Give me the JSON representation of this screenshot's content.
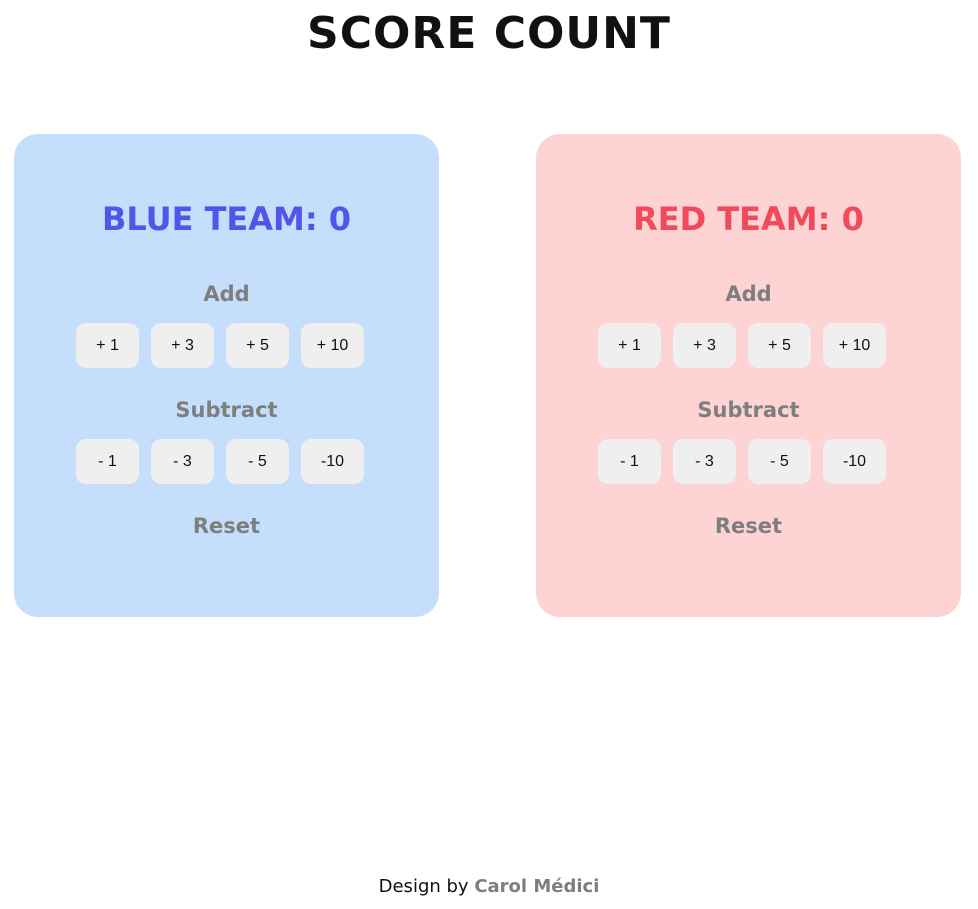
{
  "page": {
    "title": "SCORE COUNT"
  },
  "teams": {
    "blue": {
      "label": "BLUE TEAM:",
      "score": "0",
      "color": "#5155ea",
      "card_color": "#c4defb"
    },
    "red": {
      "label": "RED TEAM:",
      "score": "0",
      "color": "#f04b5a",
      "card_color": "#fdd3d4"
    }
  },
  "controls": {
    "add_label": "Add",
    "subtract_label": "Subtract",
    "reset_label": "Reset",
    "add_buttons": [
      "+ 1",
      "+ 3",
      "+ 5",
      "+ 10"
    ],
    "subtract_buttons": [
      "- 1",
      "- 3",
      "- 5",
      "-10"
    ]
  },
  "footer": {
    "prefix": "Design by",
    "author": "Carol Médici"
  }
}
